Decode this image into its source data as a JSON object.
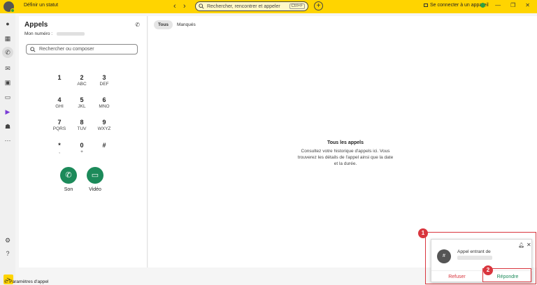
{
  "topbar": {
    "status_label": "Définir un statut",
    "search_placeholder": "Rechercher, rencontrer et appeler",
    "search_shortcut": "Ctrl+F",
    "connect_label": "Se connecter à un appareil"
  },
  "calls": {
    "title": "Appels",
    "my_number_label": "Mon numéro :",
    "search_placeholder": "Rechercher ou composer",
    "keys": [
      {
        "digit": "1",
        "letters": ""
      },
      {
        "digit": "2",
        "letters": "ABC"
      },
      {
        "digit": "3",
        "letters": "DEF"
      },
      {
        "digit": "4",
        "letters": "GHI"
      },
      {
        "digit": "5",
        "letters": "JKL"
      },
      {
        "digit": "6",
        "letters": "MNO"
      },
      {
        "digit": "7",
        "letters": "PQRS"
      },
      {
        "digit": "8",
        "letters": "TUV"
      },
      {
        "digit": "9",
        "letters": "WXYZ"
      },
      {
        "digit": "*",
        "letters": ","
      },
      {
        "digit": "0",
        "letters": "+"
      },
      {
        "digit": "#",
        "letters": ""
      }
    ],
    "voice_label": "Son",
    "video_label": "Vidéo",
    "settings_label": "Paramètres d'appel"
  },
  "main": {
    "tabs": [
      "Tous",
      "Manqués"
    ],
    "empty_title": "Tous les appels",
    "empty_desc": "Consultez votre historique d'appels ici. Vous trouverez les détails de l'appel ainsi que la date et la durée."
  },
  "notification": {
    "avatar_glyph": "#",
    "title": "Appel entrant de",
    "refuse_label": "Refuser",
    "answer_label": "Répondre"
  },
  "annotations": {
    "badge1": "1",
    "badge2": "2"
  },
  "colors": {
    "accent": "#ffd400",
    "call_green": "#1c8a5a",
    "highlight_red": "#d9363e"
  }
}
